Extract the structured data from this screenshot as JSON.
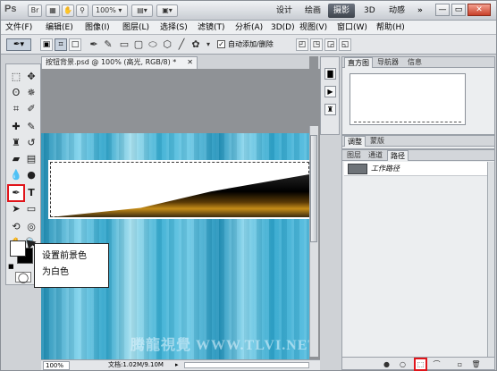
{
  "app": {
    "logo": "Ps"
  },
  "titlebar": {
    "zoom": "100%",
    "workspaces": [
      "设计",
      "绘画",
      "摄影",
      "3D",
      "动感"
    ],
    "active_workspace": "摄影",
    "more": "»",
    "win_minimize": "—",
    "win_restore": "▭",
    "win_close": "✕"
  },
  "menu": [
    "文件(F)",
    "编辑(E)",
    "图像(I)",
    "图层(L)",
    "选择(S)",
    "滤镜(T)",
    "分析(A)",
    "3D(D)",
    "视图(V)",
    "窗口(W)",
    "帮助(H)"
  ],
  "options": {
    "auto_add_delete": "自动添加/删除",
    "auto_add_checked": true
  },
  "document": {
    "tab_title": "按钮背景.psd @ 100% (高光, RGB/8) *",
    "zoom": "100%",
    "info": "文档:1.02M/9.10M",
    "watermark": "腾龍視覺 WWW.TLVI.NET"
  },
  "panels": {
    "top_tabs": [
      "直方图",
      "导航器",
      "信息"
    ],
    "mid_tabs": [
      "调整",
      "蒙版"
    ],
    "bottom_tabs": [
      "图层",
      "通道",
      "路径"
    ],
    "active_bottom_tab": "路径",
    "paths": [
      {
        "name": "工作路径"
      }
    ]
  },
  "callout": {
    "line1": "设置前景色",
    "line2": "为白色"
  },
  "colors": {
    "accent_red": "#e0151b",
    "foreground": "#ffffff",
    "background": "#000000"
  }
}
